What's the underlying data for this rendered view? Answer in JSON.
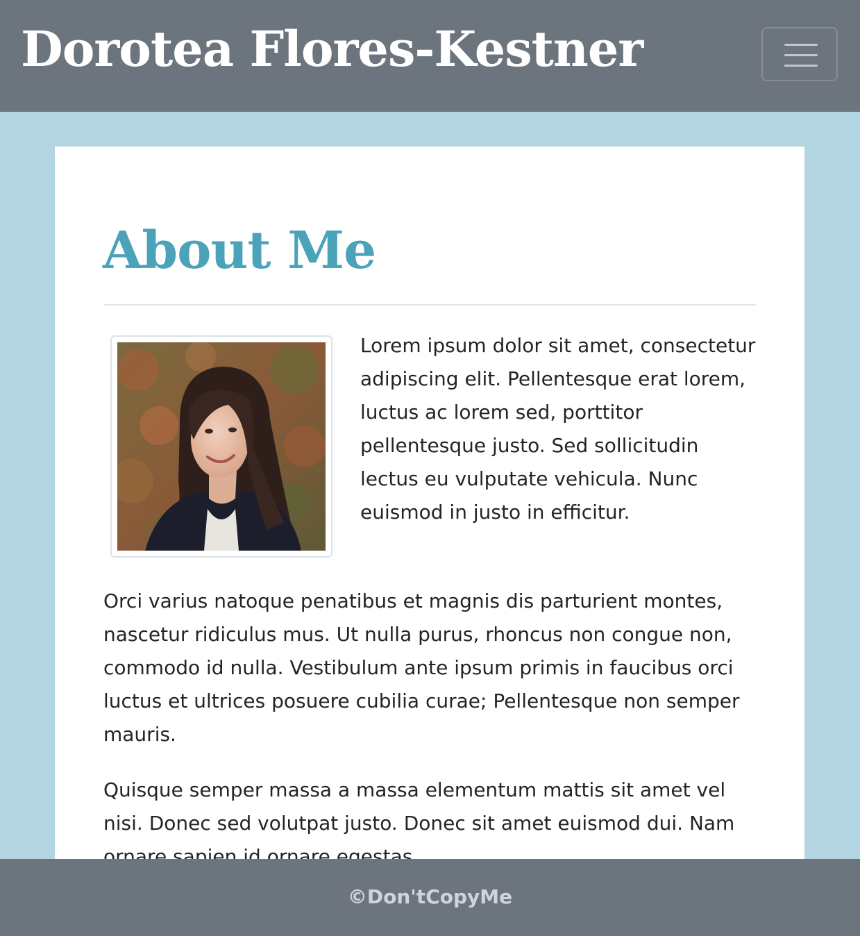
{
  "navbar": {
    "brand": "Dorotea Flores-Kestner",
    "toggler_icon": "hamburger-menu-icon"
  },
  "main": {
    "title": "About Me",
    "profile_photo": "portrait-photo",
    "paragraphs": [
      "Lorem ipsum dolor sit amet, consectetur adipiscing elit. Pellentesque erat lorem, luctus ac lorem sed, porttitor pellentesque justo. Sed sollicitudin lectus eu vulputate vehicula. Nunc euismod in justo in efficitur.",
      "Orci varius natoque penatibus et magnis dis parturient montes, nascetur ridiculus mus. Ut nulla purus, rhoncus non congue non, commodo id nulla. Vestibulum ante ipsum primis in faucibus orci luctus et ultrices posuere cubilia curae; Pellentesque non semper mauris.",
      "Quisque semper massa a massa elementum mattis sit amet vel nisi. Donec sed volutpat justo. Donec sit amet euismod dui. Nam ornare sapien id ornare egestas."
    ]
  },
  "footer": {
    "text": "©Don'tCopyMe"
  },
  "colors": {
    "navbar_bg": "#6c757d",
    "page_bg": "#b3d6e2",
    "title_accent": "#4aa3b8"
  }
}
